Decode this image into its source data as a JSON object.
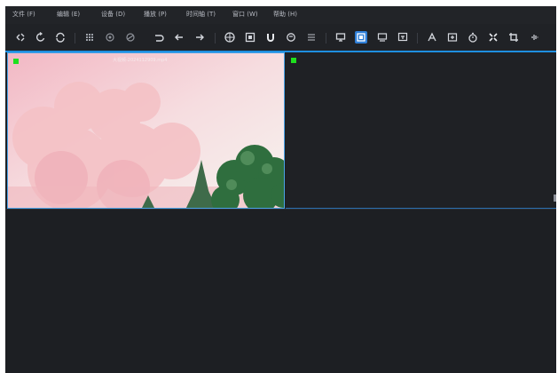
{
  "menu": [
    {
      "label": "文件 (F)"
    },
    {
      "label": "编辑 (E)"
    },
    {
      "label": "设备 (D)"
    },
    {
      "label": "播放 (P)"
    },
    {
      "label": "时间轴 (T)"
    },
    {
      "label": "窗口 (W)"
    },
    {
      "label": "帮助 (H)"
    }
  ],
  "toolbar": {
    "icons": [
      "scatter-icon",
      "redo-circle-icon",
      "refresh-icon",
      "grid-icon",
      "settings-circle-icon",
      "settings-alt-icon",
      "undo-icon",
      "undo-back-icon",
      "redo-forward-icon",
      "globe-icon",
      "frame-icon",
      "magnet-icon",
      "hand-icon",
      "list-icon",
      "monitor-icon",
      "layout-icon",
      "subtitle-icon",
      "caption-icon",
      "text-icon",
      "crop-box-icon",
      "timer-icon",
      "fit-icon",
      "crop-icon",
      "audio-icon"
    ],
    "active_icon": "layout-icon"
  },
  "preview": {
    "clip_name": "大视频-2024112909.mp4"
  },
  "colors": {
    "app_bg": "#1d1f23",
    "accent": "#1e8fe0",
    "marker": "#1ee01e"
  }
}
